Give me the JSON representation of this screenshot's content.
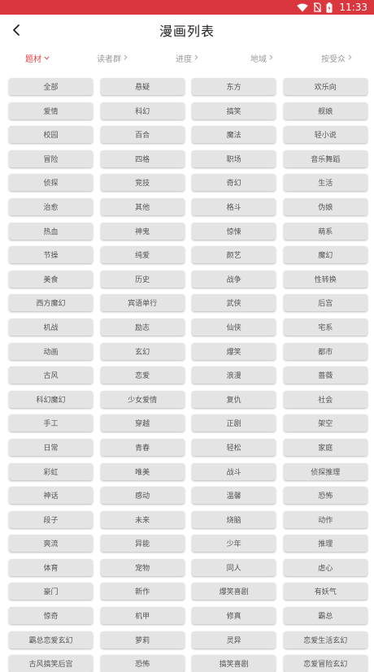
{
  "colors": {
    "status_bar": "#d9363e",
    "active_tab": "#e0434b",
    "tag_bg": "#e4e4e4"
  },
  "status_bar": {
    "time": "11:33",
    "icons": [
      "wifi-icon",
      "no-sim-icon",
      "battery-icon"
    ]
  },
  "header": {
    "title": "漫画列表",
    "back_icon": "back-arrow-icon"
  },
  "filters": [
    {
      "label": "题材",
      "active": true
    },
    {
      "label": "读者群",
      "active": false
    },
    {
      "label": "进度",
      "active": false
    },
    {
      "label": "地域",
      "active": false
    },
    {
      "label": "按受众",
      "active": false
    }
  ],
  "tags": [
    "全部",
    "悬疑",
    "东方",
    "欢乐向",
    "爱情",
    "科幻",
    "搞笑",
    "舰娘",
    "校园",
    "百合",
    "魔法",
    "轻小说",
    "冒险",
    "四格",
    "职场",
    "音乐舞蹈",
    "侦探",
    "竞技",
    "奇幻",
    "生活",
    "治愈",
    "其他",
    "格斗",
    "伪娘",
    "热血",
    "神鬼",
    "惊悚",
    "萌系",
    "节操",
    "纯爱",
    "颜艺",
    "魔幻",
    "美食",
    "历史",
    "战争",
    "性转换",
    "西方魔幻",
    "宾语单行",
    "武侠",
    "后宫",
    "机战",
    "励志",
    "仙侠",
    "宅系",
    "动画",
    "玄幻",
    "爆笑",
    "都市",
    "古风",
    "恋爱",
    "浪漫",
    "蔷薇",
    "科幻魔幻",
    "少女爱情",
    "复仇",
    "社会",
    "手工",
    "穿越",
    "正剧",
    "架空",
    "日常",
    "青春",
    "轻松",
    "家庭",
    "彩虹",
    "唯美",
    "战斗",
    "侦探推理",
    "神话",
    "感动",
    "温馨",
    "恐怖",
    "段子",
    "未来",
    "烧脑",
    "动作",
    "爽流",
    "异能",
    "少年",
    "推理",
    "体育",
    "宠物",
    "同人",
    "虐心",
    "豪门",
    "新作",
    "爆笑喜剧",
    "有妖气",
    "惊奇",
    "机甲",
    "修真",
    "霸总",
    "霸总恋爱玄幻",
    "萝莉",
    "灵异",
    "恋爱生活玄幻",
    "古风搞笑后宫",
    "恐怖",
    "搞笑喜剧",
    "恋爱冒险玄幻"
  ]
}
